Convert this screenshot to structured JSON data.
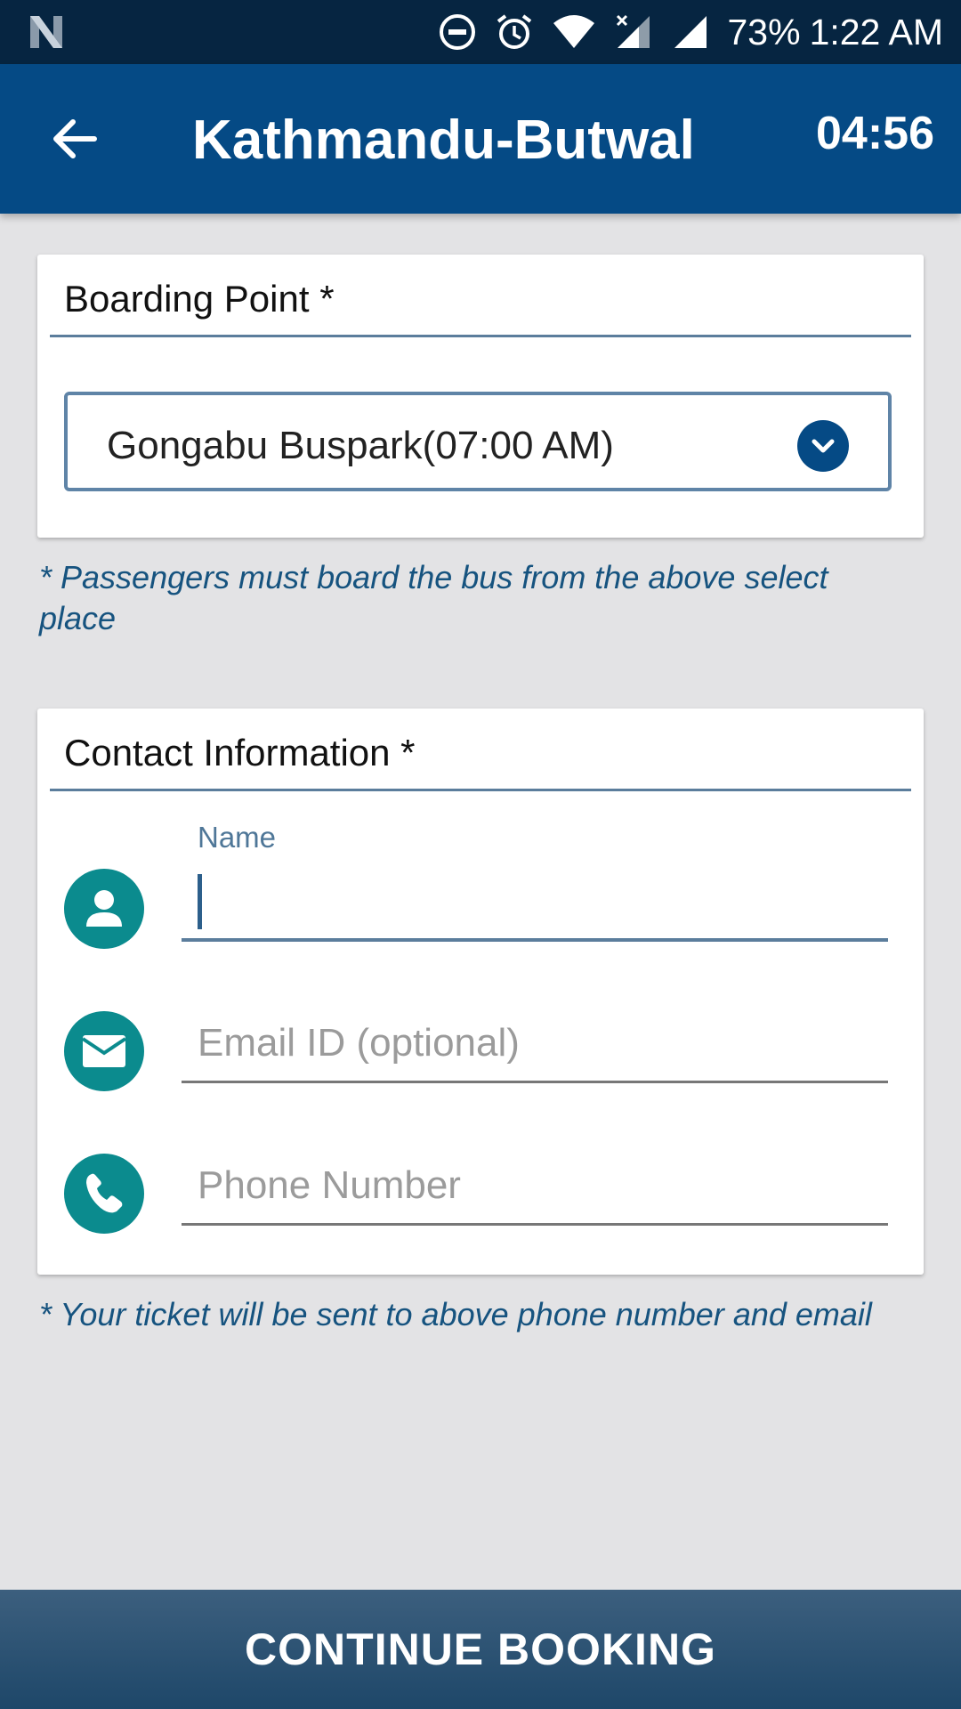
{
  "status_bar": {
    "battery": "73%",
    "time": "1:22 AM"
  },
  "app_bar": {
    "title": "Kathmandu-Butwal",
    "timer": "04:56"
  },
  "boarding": {
    "title": "Boarding Point *",
    "selected": "Gongabu Buspark(07:00 AM)",
    "note": "* Passengers must board the bus from the above select place"
  },
  "contact": {
    "title": "Contact Information *",
    "name_label": "Name",
    "name_value": "",
    "email_placeholder": "Email ID (optional)",
    "phone_placeholder": "Phone Number",
    "note": "* Your ticket will be sent to above phone number and email"
  },
  "footer": {
    "continue_label": "CONTINUE BOOKING"
  },
  "colors": {
    "status_bar": "#062541",
    "app_bar": "#054a85",
    "icon_teal": "#0b8b8e",
    "note_text": "#16537f"
  }
}
